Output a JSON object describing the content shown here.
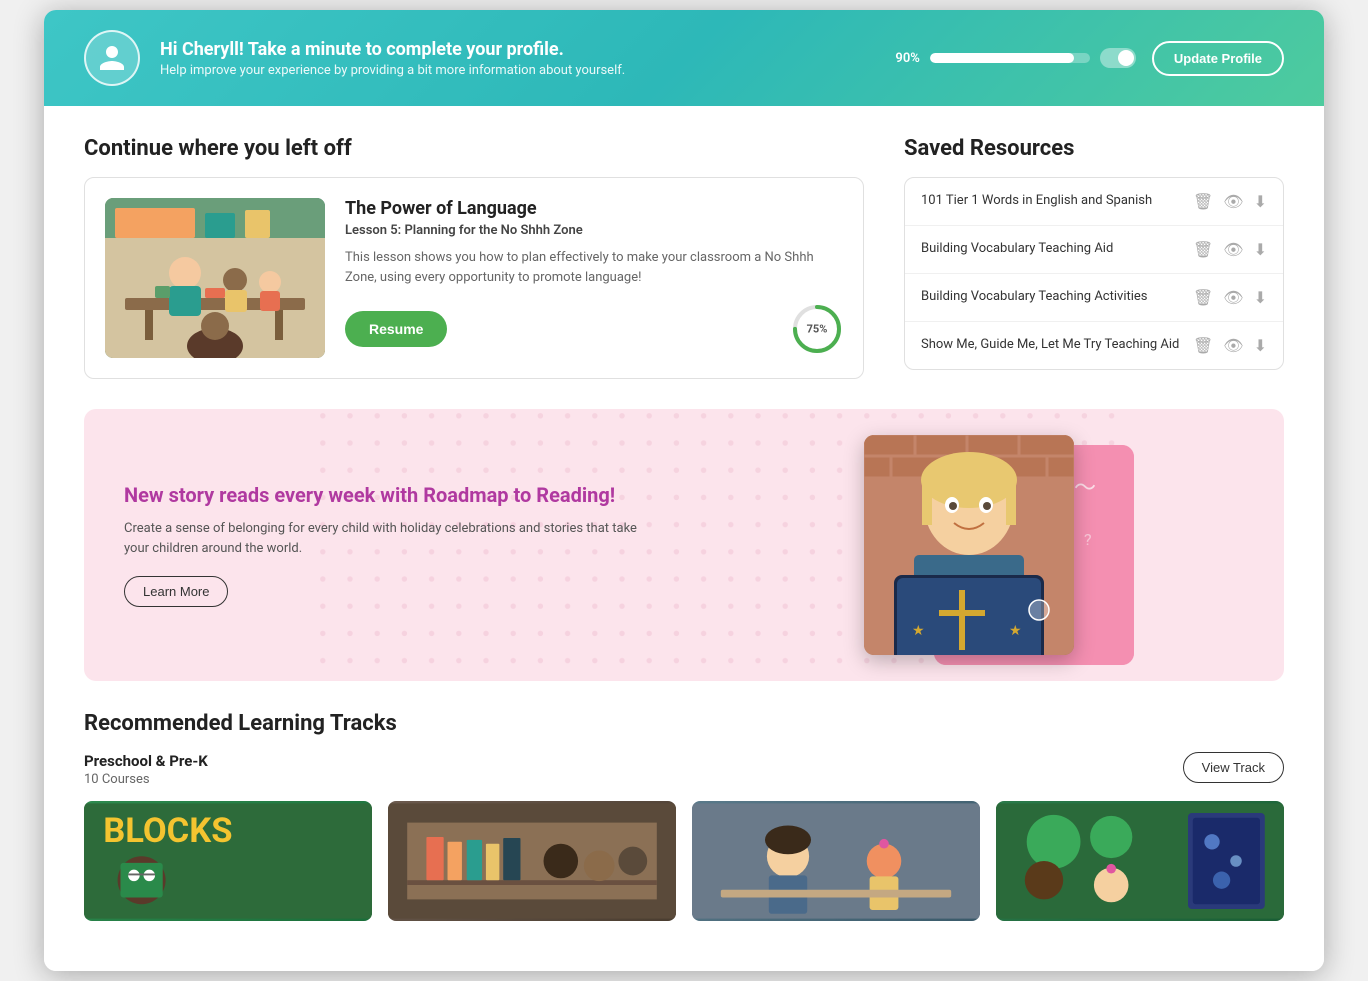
{
  "banner": {
    "title": "Hi Cheryll! Take a minute to complete your profile.",
    "subtitle": "Help improve your experience by providing a bit more information about yourself.",
    "progress_label": "90%",
    "progress_percent": 90,
    "update_btn": "Update Profile"
  },
  "continue_section": {
    "title": "Continue where you left off",
    "card": {
      "lesson_title": "The Power of Language",
      "lesson_subtitle": "Lesson 5: Planning for the No Shhh Zone",
      "lesson_desc": "This lesson shows you how to plan effectively to make your classroom a No Shhh Zone, using every opportunity to promote language!",
      "resume_btn": "Resume",
      "progress_pct": "75%",
      "progress_value": 75
    }
  },
  "saved_resources": {
    "title": "Saved Resources",
    "items": [
      {
        "name": "101 Tier 1 Words in English and Spanish"
      },
      {
        "name": "Building Vocabulary Teaching Aid"
      },
      {
        "name": "Building Vocabulary Teaching Activities"
      },
      {
        "name": "Show Me, Guide Me, Let Me Try Teaching Aid"
      }
    ]
  },
  "promo": {
    "title": "New story reads every week with Roadmap to Reading!",
    "desc": "Create a sense of belonging for every child with holiday celebrations and stories that take your children around the world.",
    "learn_more_btn": "Learn More"
  },
  "recommended": {
    "section_title": "Recommended Learning Tracks",
    "track_title": "Preschool & Pre-K",
    "track_count": "10 Courses",
    "view_track_btn": "View Track"
  },
  "icons": {
    "delete": "🗑",
    "view": "👁",
    "download": "⬇"
  }
}
